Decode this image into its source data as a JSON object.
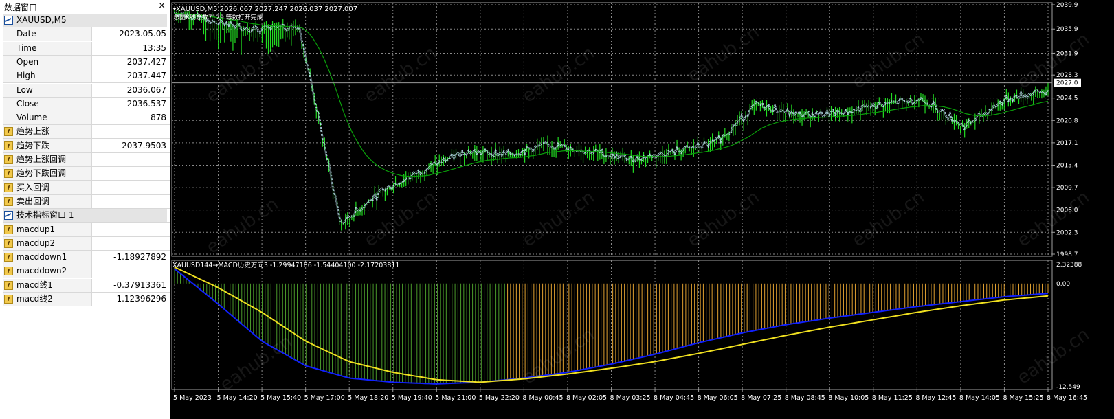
{
  "data_window": {
    "title": "数据窗口",
    "close_glyph": "×",
    "rows": [
      {
        "label": "XAUUSD,M5",
        "value": "",
        "kind": "section",
        "icon": "chart-window-icon"
      },
      {
        "label": "Date",
        "value": "2023.05.05",
        "kind": "field"
      },
      {
        "label": "Time",
        "value": "13:35",
        "kind": "field"
      },
      {
        "label": "Open",
        "value": "2037.427",
        "kind": "field"
      },
      {
        "label": "High",
        "value": "2037.447",
        "kind": "field"
      },
      {
        "label": "Low",
        "value": "2036.067",
        "kind": "field"
      },
      {
        "label": "Close",
        "value": "2036.537",
        "kind": "field"
      },
      {
        "label": "Volume",
        "value": "878",
        "kind": "field"
      },
      {
        "label": "趋势上涨",
        "value": "",
        "kind": "indicator",
        "icon": "custom-indicator-icon"
      },
      {
        "label": "趋势下跌",
        "value": "2037.9503",
        "kind": "indicator",
        "icon": "custom-indicator-icon"
      },
      {
        "label": "趋势上涨回调",
        "value": "",
        "kind": "indicator",
        "icon": "custom-indicator-icon"
      },
      {
        "label": "趋势下跌回调",
        "value": "",
        "kind": "indicator",
        "icon": "custom-indicator-icon"
      },
      {
        "label": "买入回调",
        "value": "",
        "kind": "indicator",
        "icon": "custom-indicator-icon"
      },
      {
        "label": "卖出回调",
        "value": "",
        "kind": "indicator",
        "icon": "custom-indicator-icon"
      },
      {
        "label": "技术指标窗口 1",
        "value": "",
        "kind": "section",
        "icon": "chart-window-icon"
      },
      {
        "label": "macdup1",
        "value": "",
        "kind": "indicator",
        "icon": "custom-indicator-icon"
      },
      {
        "label": "macdup2",
        "value": "",
        "kind": "indicator",
        "icon": "custom-indicator-icon"
      },
      {
        "label": "macddown1",
        "value": "-1.18927892",
        "kind": "indicator",
        "icon": "custom-indicator-icon"
      },
      {
        "label": "macddown2",
        "value": "",
        "kind": "indicator",
        "icon": "custom-indicator-icon"
      },
      {
        "label": "macd线1",
        "value": "-0.37913361",
        "kind": "indicator",
        "icon": "custom-indicator-icon"
      },
      {
        "label": "macd线2",
        "value": "1.12396296",
        "kind": "indicator",
        "icon": "custom-indicator-icon"
      }
    ]
  },
  "main_chart": {
    "header": "XAUUSD,M5  2026.067 2027.247 2026.037 2027.007",
    "sub_header": "总图K线总数7129  等数打开完成",
    "current_price": "2027.0",
    "price_axis": [
      "2039.9",
      "2035.9",
      "2031.9",
      "2028.3",
      "2024.5",
      "2020.8",
      "2017.1",
      "2013.4",
      "2009.7",
      "2006.0",
      "2002.3",
      "1998.7"
    ]
  },
  "sub_window": {
    "header": "XAUUSD144→MACD历史方向3 -1.29947186 -1.54404100 -2.17203811",
    "axis": [
      "2.32388",
      "0.00",
      "-12.549"
    ]
  },
  "time_axis": [
    "5 May 2023",
    "5 May 14:20",
    "5 May 15:40",
    "5 May 17:00",
    "5 May 18:20",
    "5 May 19:40",
    "5 May 21:00",
    "5 May 22:20",
    "8 May 00:45",
    "8 May 02:05",
    "8 May 03:25",
    "8 May 04:45",
    "8 May 06:05",
    "8 May 07:25",
    "8 May 08:45",
    "8 May 10:05",
    "8 May 11:25",
    "8 May 12:45",
    "8 May 14:05",
    "8 May 15:25",
    "8 May 16:45"
  ],
  "watermark": "eahub.cn",
  "colors": {
    "background": "#000000",
    "grid": "#8a8a8a",
    "candle_up": "#22dd22",
    "trend_line": "#bfe6f5",
    "ma_line": "#0aa00a",
    "hist_negative_green": "#4a9a2a",
    "hist_orange": "#e0a030",
    "macd_blue": "#1020ff",
    "macd_yellow": "#f0e020"
  },
  "chart_data": {
    "type": "line",
    "title": "XAUUSD,M5",
    "price_range": [
      1998.7,
      2039.9
    ],
    "series": [
      {
        "name": "",
        "values": [
          2038.5,
          2036.8,
          2035.6,
          2036.2,
          2003.5,
          2009.0,
          2012.5,
          2015.5,
          2015.0,
          2016.6,
          2015.5,
          2014.2,
          2015.4,
          2016.9,
          2023.2,
          2021.5,
          2021.8,
          2023.2,
          2024.2,
          2019.6,
          2024.2,
          2025.5
        ]
      }
    ],
    "x": [
      "5 May 2023",
      "5 May 14:20",
      "5 May 15:40",
      "5 May 17:00",
      "5 May 18:20",
      "5 May 19:40",
      "5 May 21:00",
      "5 May 22:20",
      "8 May 00:45",
      "8 May 02:05",
      "8 May 03:25",
      "8 May 04:45",
      "8 May 06:05",
      "8 May 07:25",
      "8 May 08:45",
      "8 May 10:05",
      "8 May 11:25",
      "8 May 12:45",
      "8 May 14:05",
      "8 May 15:25",
      "8 May 16:45"
    ],
    "macd_subwindow": {
      "range": [
        -12.549,
        2.32388
      ],
      "series": [
        {
          "name": "",
          "values": [
            1.8,
            -2.5,
            -7.0,
            -10.0,
            -11.5,
            -12.0,
            -12.2,
            -12.0,
            -11.5,
            -10.8,
            -9.8,
            -8.6,
            -7.2,
            -6.0,
            -5.0,
            -4.2,
            -3.5,
            -2.8,
            -2.2,
            -1.6,
            -1.2
          ]
        },
        {
          "name": "",
          "values": [
            2.0,
            -0.5,
            -3.5,
            -7.0,
            -9.5,
            -10.8,
            -11.7,
            -12.0,
            -11.6,
            -11.0,
            -10.3,
            -9.5,
            -8.5,
            -7.4,
            -6.3,
            -5.3,
            -4.4,
            -3.5,
            -2.7,
            -2.0,
            -1.5
          ]
        }
      ]
    }
  }
}
